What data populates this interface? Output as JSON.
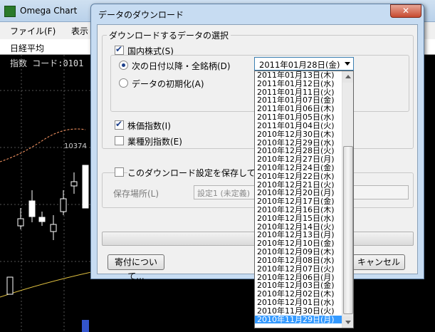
{
  "app": {
    "title": "Omega Chart",
    "menu": [
      "ファイル(F)",
      "表示"
    ],
    "combo_value": "日経平均",
    "info_text": "指数 コード:0101",
    "price_label": "10374"
  },
  "dialog": {
    "title": "データのダウンロード",
    "close_label": "✕",
    "group_label": "ダウンロードするデータの選択",
    "domestic_stocks": "国内株式(S)",
    "radio_next": "次の日付以降・全銘柄(D)",
    "radio_init": "データの初期化(A)",
    "stock_index": "株価指数(I)",
    "sector_index": "業種別指数(E)",
    "save_setting": "このダウンロード設定を保存して次回以",
    "save_location_label": "保存場所(L)",
    "save_location_value": "設定1 (未定義)",
    "about_button": "寄付について...",
    "cancel_button": "キャンセル"
  },
  "dropdown": {
    "selected": "2011年01月28日(金)",
    "items": [
      "2011年01月13日(木)",
      "2011年01月12日(水)",
      "2011年01月11日(火)",
      "2011年01月07日(金)",
      "2011年01月06日(木)",
      "2011年01月05日(水)",
      "2011年01月04日(火)",
      "2010年12月30日(木)",
      "2010年12月29日(水)",
      "2010年12月28日(火)",
      "2010年12月27日(月)",
      "2010年12月24日(金)",
      "2010年12月22日(水)",
      "2010年12月21日(火)",
      "2010年12月20日(月)",
      "2010年12月17日(金)",
      "2010年12月16日(木)",
      "2010年12月15日(水)",
      "2010年12月14日(火)",
      "2010年12月13日(月)",
      "2010年12月10日(金)",
      "2010年12月09日(木)",
      "2010年12月08日(水)",
      "2010年12月07日(火)",
      "2010年12月06日(月)",
      "2010年12月03日(金)",
      "2010年12月02日(木)",
      "2010年12月01日(水)",
      "2010年11月30日(火)",
      "2010年11月29日(月)"
    ],
    "highlighted_index": 29
  }
}
